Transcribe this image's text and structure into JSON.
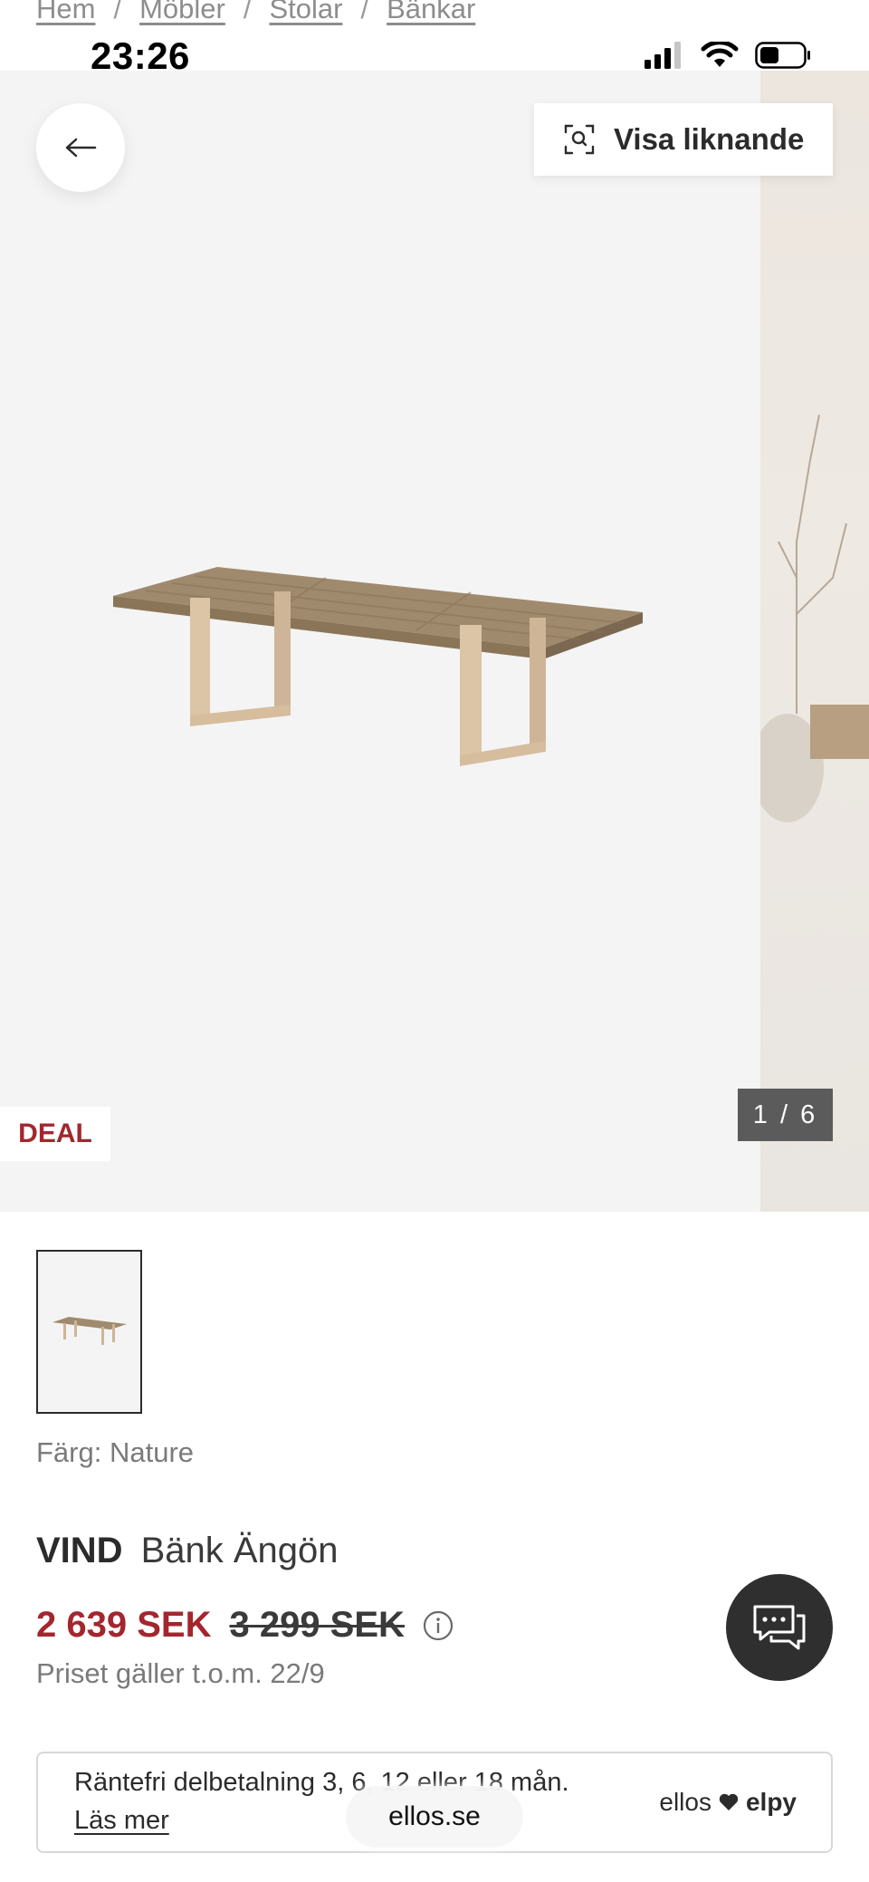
{
  "breadcrumb": {
    "items": [
      "Hem",
      "Möbler",
      "Stolar",
      "Bänkar"
    ],
    "separator": "/"
  },
  "status_bar": {
    "time": "23:26",
    "icons": [
      "cellular-signal-icon",
      "wifi-icon",
      "battery-icon"
    ]
  },
  "gallery": {
    "similar_label": "Visa liknande",
    "deal_badge": "DEAL",
    "counter": "1 / 6"
  },
  "product": {
    "color_label": "Färg: Nature",
    "brand": "VIND",
    "name": "Bänk Ängön",
    "price_now": "2 639 SEK",
    "price_old": "3 299 SEK",
    "price_valid": "Priset gäller t.o.m. 22/9"
  },
  "finance": {
    "text": "Räntefri delbetalning 3, 6, 12 eller 18 mån.",
    "link": "Läs mer",
    "logo_ellos": "ellos",
    "logo_elpy": "elpy"
  },
  "browser": {
    "site": "ellos.se"
  },
  "colors": {
    "sale_red": "#a3262e",
    "text_dark": "#2b2b2b",
    "muted": "#7a7a7a",
    "image_bg": "#f4f4f4"
  }
}
